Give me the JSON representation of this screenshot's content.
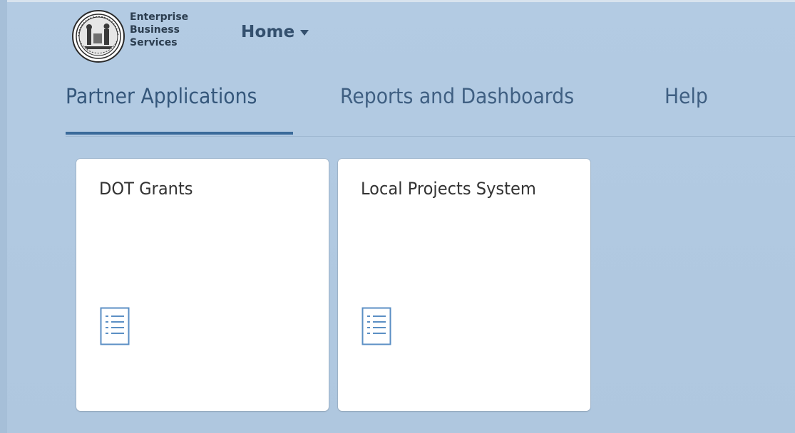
{
  "header": {
    "logo": {
      "icon": "state-seal-icon",
      "lines": [
        "Enterprise",
        "Business",
        "Services"
      ]
    },
    "home_menu": {
      "label": "Home",
      "icon": "caret-down-icon"
    }
  },
  "tabs": [
    {
      "label": "Partner Applications",
      "selected": true
    },
    {
      "label": "Reports and Dashboards",
      "selected": false
    },
    {
      "label": "Help",
      "selected": false
    }
  ],
  "tiles": [
    {
      "title": "DOT Grants",
      "icon": "list-document-icon"
    },
    {
      "title": "Local Projects System",
      "icon": "list-document-icon"
    }
  ],
  "colors": {
    "background": "#b1c9e1",
    "tab_text": "#3f5f82",
    "tab_underline": "#3a6a9a",
    "tile_background": "#ffffff",
    "tile_icon": "#5b8fc4",
    "home_text": "#34506e"
  }
}
